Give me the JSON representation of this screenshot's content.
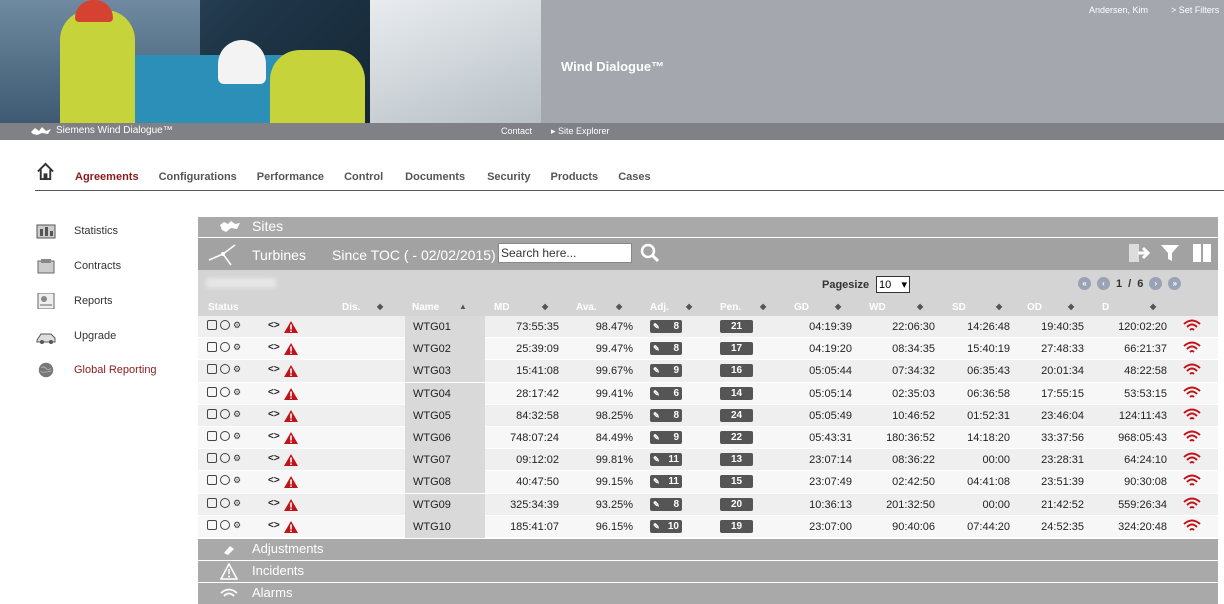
{
  "header": {
    "user": "Andersen, Kim",
    "set_filters": "> Set Filters",
    "app_title": "Wind Dialogue™",
    "brand": "Siemens Wind Dialogue™",
    "contact": "Contact",
    "site_explorer": "Site Explorer"
  },
  "nav": {
    "items": [
      "Agreements",
      "Configurations",
      "Performance",
      "Control",
      "Documents",
      "Security",
      "Products",
      "Cases"
    ],
    "active": "Agreements"
  },
  "sidebar": {
    "items": [
      {
        "label": "Statistics",
        "icon": "statistics-icon"
      },
      {
        "label": "Contracts",
        "icon": "contracts-icon"
      },
      {
        "label": "Reports",
        "icon": "reports-icon"
      },
      {
        "label": "Upgrade",
        "icon": "upgrade-icon"
      },
      {
        "label": "Global Reporting",
        "icon": "globe-icon"
      }
    ],
    "active": "Global Reporting"
  },
  "sites": {
    "label": "Sites"
  },
  "turbines": {
    "label": "Turbines",
    "since": "Since TOC ( - 02/02/2015)",
    "search_value": "Search here..."
  },
  "paging": {
    "pagesize_label": "Pagesize",
    "pagesize": "10",
    "page": "1",
    "of": "/",
    "total": "6"
  },
  "columns": {
    "status": "Status",
    "dis": "Dis.",
    "name": "Name",
    "md": "MD",
    "ava": "Ava.",
    "adj": "Adj.",
    "pen": "Pen.",
    "gd": "GD",
    "wd": "WD",
    "sd": "SD",
    "od": "OD",
    "d": "D"
  },
  "rows": [
    {
      "name": "WTG01",
      "md": "73:55:35",
      "ava": "98.47%",
      "adj": "8",
      "pen": "21",
      "gd": "04:19:39",
      "wd": "22:06:30",
      "sd": "14:26:48",
      "od": "19:40:35",
      "d": "120:02:20"
    },
    {
      "name": "WTG02",
      "md": "25:39:09",
      "ava": "99.47%",
      "adj": "8",
      "pen": "17",
      "gd": "04:19:20",
      "wd": "08:34:35",
      "sd": "15:40:19",
      "od": "27:48:33",
      "d": "66:21:37"
    },
    {
      "name": "WTG03",
      "md": "15:41:08",
      "ava": "99.67%",
      "adj": "9",
      "pen": "16",
      "gd": "05:05:44",
      "wd": "07:34:32",
      "sd": "06:35:43",
      "od": "20:01:34",
      "d": "48:22:58"
    },
    {
      "name": "WTG04",
      "md": "28:17:42",
      "ava": "99.41%",
      "adj": "6",
      "pen": "14",
      "gd": "05:05:14",
      "wd": "02:35:03",
      "sd": "06:36:58",
      "od": "17:55:15",
      "d": "53:53:15"
    },
    {
      "name": "WTG05",
      "md": "84:32:58",
      "ava": "98.25%",
      "adj": "8",
      "pen": "24",
      "gd": "05:05:49",
      "wd": "10:46:52",
      "sd": "01:52:31",
      "od": "23:46:04",
      "d": "124:11:43"
    },
    {
      "name": "WTG06",
      "md": "748:07:24",
      "ava": "84.49%",
      "adj": "9",
      "pen": "22",
      "gd": "05:43:31",
      "wd": "180:36:52",
      "sd": "14:18:20",
      "od": "33:37:56",
      "d": "968:05:43"
    },
    {
      "name": "WTG07",
      "md": "09:12:02",
      "ava": "99.81%",
      "adj": "11",
      "pen": "13",
      "gd": "23:07:14",
      "wd": "08:36:22",
      "sd": "00:00",
      "od": "23:28:31",
      "d": "64:24:10"
    },
    {
      "name": "WTG08",
      "md": "40:47:50",
      "ava": "99.15%",
      "adj": "11",
      "pen": "15",
      "gd": "23:07:49",
      "wd": "02:42:50",
      "sd": "04:41:08",
      "od": "23:51:39",
      "d": "90:30:08"
    },
    {
      "name": "WTG09",
      "md": "325:34:39",
      "ava": "93.25%",
      "adj": "8",
      "pen": "20",
      "gd": "10:36:13",
      "wd": "201:32:50",
      "sd": "00:00",
      "od": "21:42:52",
      "d": "559:26:34"
    },
    {
      "name": "WTG10",
      "md": "185:41:07",
      "ava": "96.15%",
      "adj": "10",
      "pen": "19",
      "gd": "23:07:00",
      "wd": "90:40:06",
      "sd": "07:44:20",
      "od": "24:52:35",
      "d": "324:20:48"
    }
  ],
  "sections": {
    "adjustments": "Adjustments",
    "incidents": "Incidents",
    "alarms": "Alarms"
  },
  "colors": {
    "accent": "#8b1a1a",
    "alert": "#c0141a",
    "panel": "#a9a9a9"
  }
}
